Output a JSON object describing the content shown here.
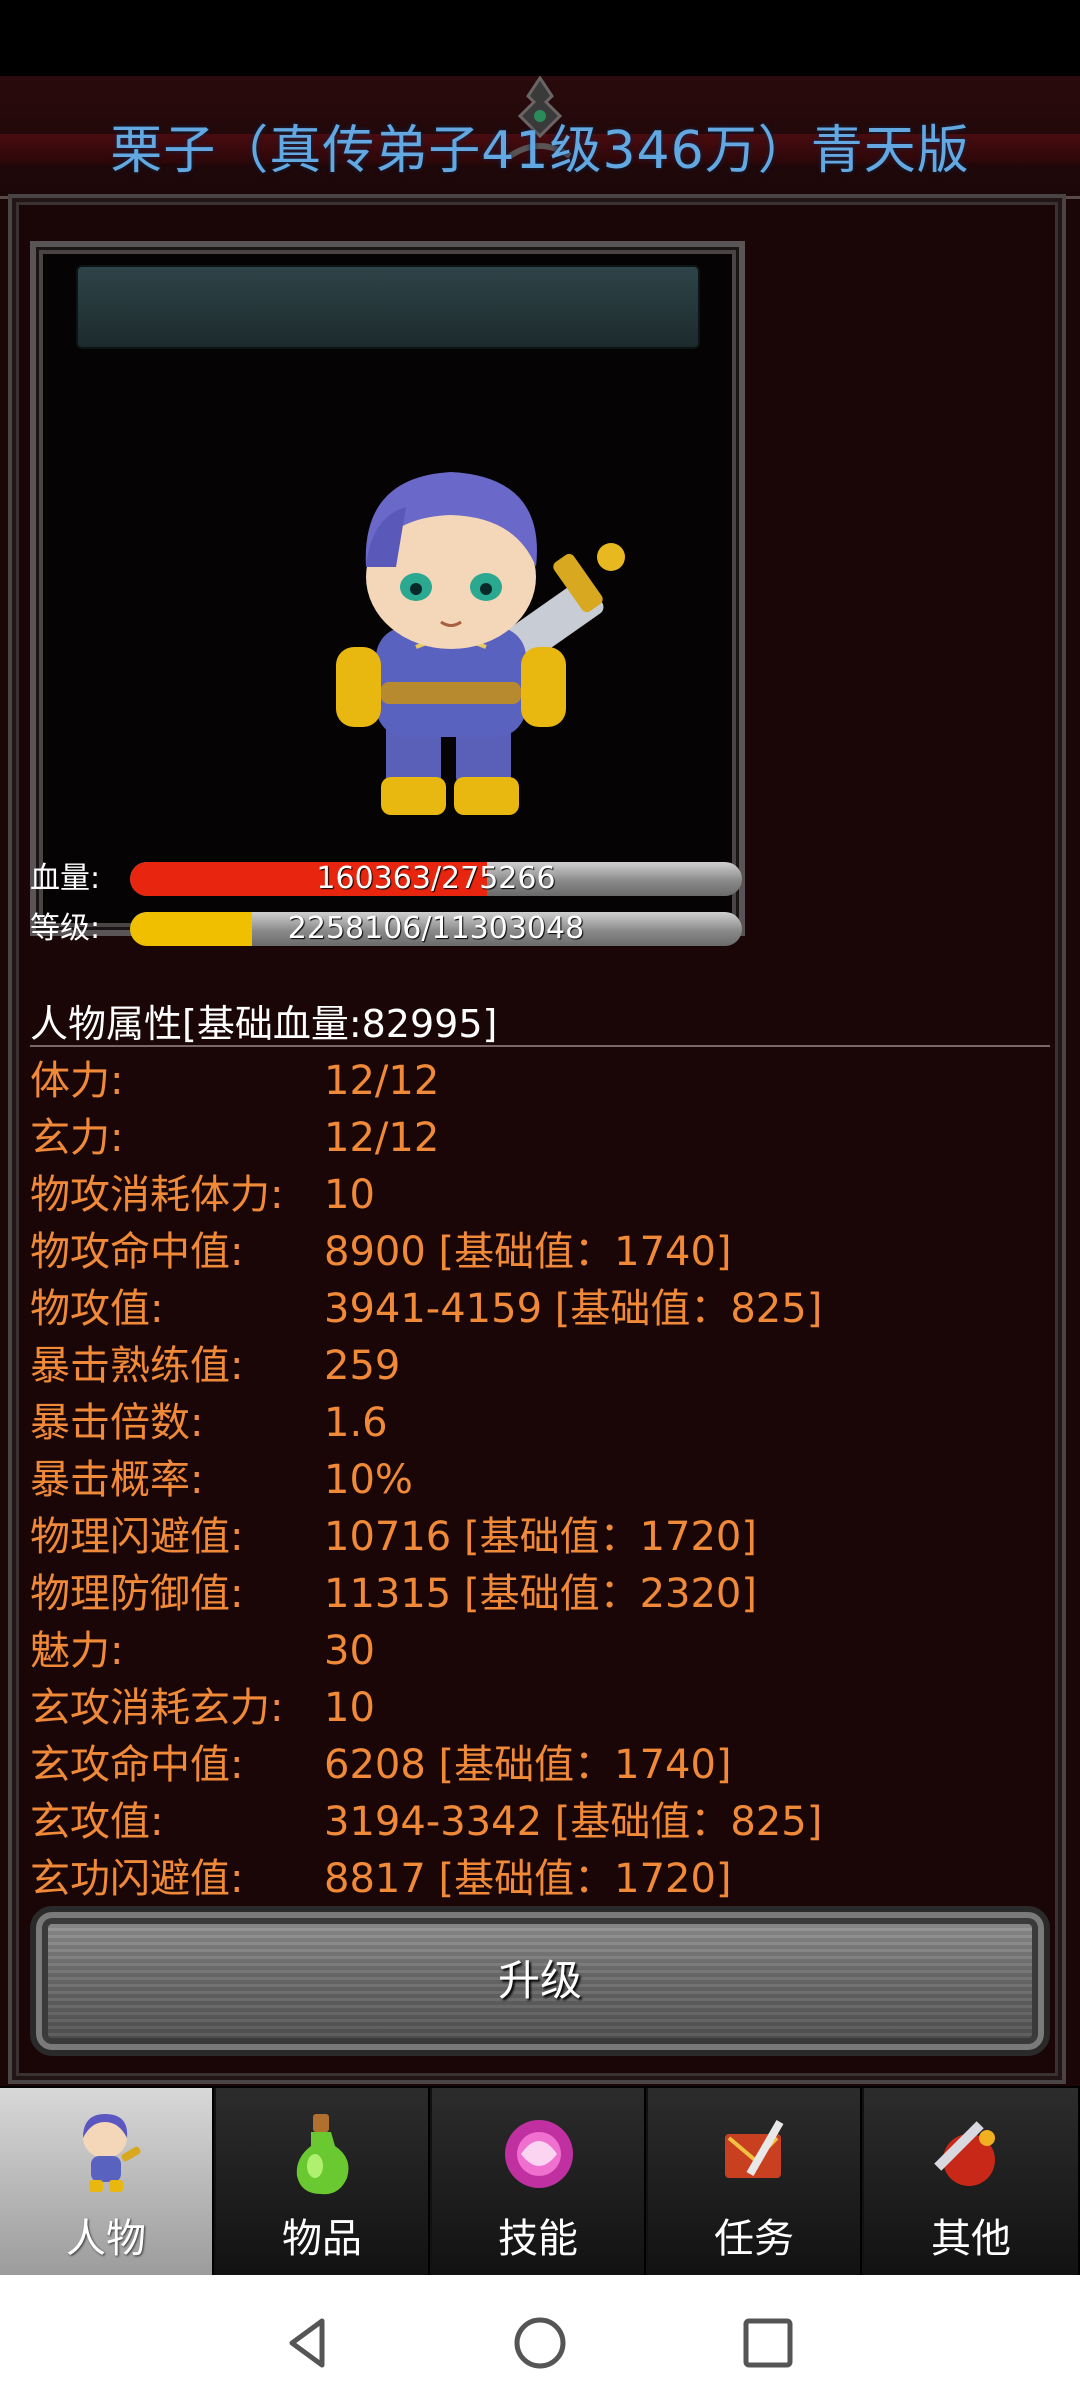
{
  "title": "栗子（真传弟子41级346万）青天版",
  "bars": {
    "hp": {
      "label": "血量:",
      "text": "160363/275266",
      "current": 160363,
      "max": 275266,
      "color": "#e8250e"
    },
    "level": {
      "label": "等级:",
      "text": "2258106/11303048",
      "current": 2258106,
      "max": 11303048,
      "color": "#f0c000"
    }
  },
  "section_heading": "人物属性[基础血量:82995]",
  "attributes": [
    {
      "key": "体力:",
      "value": "12/12"
    },
    {
      "key": "玄力:",
      "value": "12/12"
    },
    {
      "key": "物攻消耗体力:",
      "value": "10"
    },
    {
      "key": "物攻命中值:",
      "value": "8900 [基础值：1740]"
    },
    {
      "key": "物攻值:",
      "value": "3941-4159 [基础值：825]"
    },
    {
      "key": "暴击熟练值:",
      "value": "259"
    },
    {
      "key": "暴击倍数:",
      "value": "1.6"
    },
    {
      "key": "暴击概率:",
      "value": "10%"
    },
    {
      "key": "物理闪避值:",
      "value": "10716 [基础值：1720]"
    },
    {
      "key": "物理防御值:",
      "value": "11315 [基础值：2320]"
    },
    {
      "key": "魅力:",
      "value": "30"
    },
    {
      "key": "玄攻消耗玄力:",
      "value": "10"
    },
    {
      "key": "玄攻命中值:",
      "value": "6208 [基础值：1740]"
    },
    {
      "key": "玄攻值:",
      "value": "3194-3342 [基础值：825]"
    },
    {
      "key": "玄功闪避值:",
      "value": "8817 [基础值：1720]"
    }
  ],
  "upgrade_label": "升级",
  "tabs": [
    {
      "label": "人物",
      "icon": "character-icon",
      "active": true
    },
    {
      "label": "物品",
      "icon": "potion-icon",
      "active": false
    },
    {
      "label": "技能",
      "icon": "skill-orb-icon",
      "active": false
    },
    {
      "label": "任务",
      "icon": "quest-icon",
      "active": false
    },
    {
      "label": "其他",
      "icon": "other-icon",
      "active": false
    }
  ],
  "nav": [
    "back-icon",
    "home-icon",
    "recents-icon"
  ]
}
